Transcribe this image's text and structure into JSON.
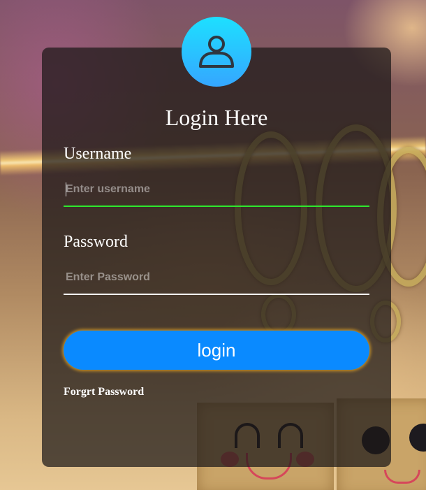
{
  "form": {
    "title": "Login Here",
    "username_label": "Username",
    "username_placeholder": "Enter username",
    "username_value": "",
    "password_label": "Password",
    "password_placeholder": "Enter Password",
    "password_value": "",
    "login_label": "login",
    "forgot_label": "Forgrt Password"
  },
  "icons": {
    "avatar": "user-icon"
  },
  "colors": {
    "avatar_gradient_top": "#1de0ff",
    "avatar_gradient_bottom": "#35a6ff",
    "username_underline": "#2ee82e",
    "password_underline": "#ffffff",
    "button": "#0a8aff",
    "button_glow": "#cd9628",
    "card_background": "rgba(28,24,24,0.72)"
  }
}
